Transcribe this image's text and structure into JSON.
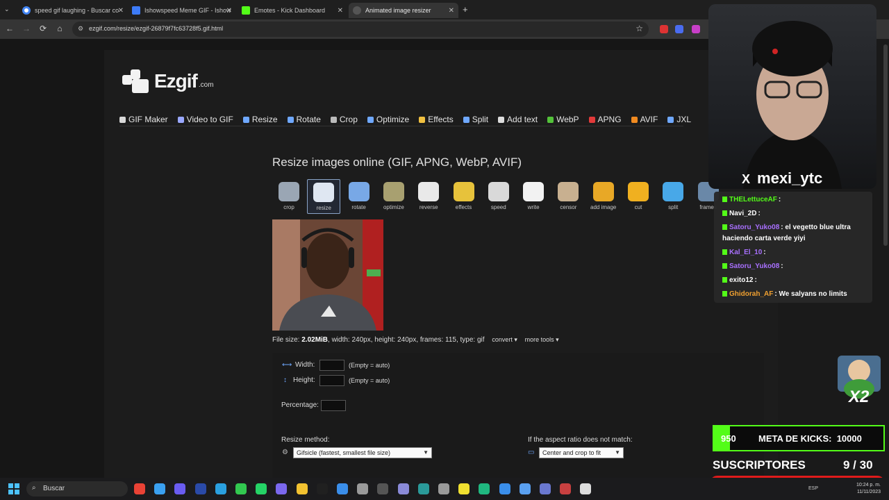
{
  "browser": {
    "tabs": [
      {
        "title": "speed gif laughing - Buscar co",
        "color": "#4285f4"
      },
      {
        "title": "Ishowspeed Meme GIF - Ishow",
        "color": "#3d7bf7"
      },
      {
        "title": "Emotes - Kick Dashboard",
        "color": "#53fc18"
      },
      {
        "title": "Animated image resizer",
        "color": "#2a2a2a"
      }
    ],
    "url": "ezgif.com/resize/ezgif-26879f7fc63728f5.gif.html",
    "new_tab": "+",
    "back": "←",
    "forward": "→",
    "reload": "⟳",
    "home": "⌂",
    "star": "☆"
  },
  "site": {
    "logo_text": "Ezgif",
    "logo_suffix": ".com",
    "nav": [
      {
        "label": "GIF Maker",
        "icon": "gif-maker-icon",
        "color": "#d8d8d8"
      },
      {
        "label": "Video to GIF",
        "icon": "video-icon",
        "color": "#9aa8ff"
      },
      {
        "label": "Resize",
        "icon": "resize-icon",
        "color": "#6fa8ff"
      },
      {
        "label": "Rotate",
        "icon": "rotate-icon",
        "color": "#6fa8ff"
      },
      {
        "label": "Crop",
        "icon": "crop-icon",
        "color": "#bbbbbb"
      },
      {
        "label": "Optimize",
        "icon": "optimize-icon",
        "color": "#6fa8ff"
      },
      {
        "label": "Effects",
        "icon": "effects-icon",
        "color": "#f0c040"
      },
      {
        "label": "Split",
        "icon": "split-icon",
        "color": "#6fa8ff"
      },
      {
        "label": "Add text",
        "icon": "add-text-icon",
        "color": "#dddddd"
      },
      {
        "label": "WebP",
        "icon": "webp-icon",
        "color": "#53c23a"
      },
      {
        "label": "APNG",
        "icon": "apng-icon",
        "color": "#e23a3a"
      },
      {
        "label": "AVIF",
        "icon": "avif-icon",
        "color": "#f08a20"
      },
      {
        "label": "JXL",
        "icon": "jxl-icon",
        "color": "#6fa8ff"
      }
    ],
    "heading": "Resize images online (GIF, APNG, WebP, AVIF)",
    "tools": [
      {
        "label": "crop",
        "color": "#9aa6b4"
      },
      {
        "label": "resize",
        "color": "#dfe7f2"
      },
      {
        "label": "rotate",
        "color": "#78a8e6"
      },
      {
        "label": "optimize",
        "color": "#a8a070"
      },
      {
        "label": "reverse",
        "color": "#e9e9e9"
      },
      {
        "label": "effects",
        "color": "#e7c23b"
      },
      {
        "label": "speed",
        "color": "#d9d9d9"
      },
      {
        "label": "write",
        "color": "#f2f2f2"
      },
      {
        "label": "censor",
        "color": "#c8b090"
      },
      {
        "label": "add image",
        "color": "#e8a826"
      },
      {
        "label": "cut",
        "color": "#f0b020"
      },
      {
        "label": "split",
        "color": "#48a8e8"
      },
      {
        "label": "frames",
        "color": "#6a88a8"
      }
    ],
    "file_info": {
      "prefix": "File size: ",
      "size": "2.02MiB",
      "rest": ", width: 240px, height: 240px, frames: 115, type: gif",
      "convert": "convert ▾",
      "more_tools": "more tools ▾"
    },
    "form": {
      "width_label": "Width:",
      "height_label": "Height:",
      "auto_hint": "(Empty = auto)",
      "percentage_label": "Percentage:",
      "method_label": "Resize method:",
      "method_value": "Gifsicle (fastest, smallest file size)",
      "aspect_label": "If the aspect ratio does not match:",
      "aspect_value": "Center and crop to fit"
    }
  },
  "stream": {
    "handle": "mexi_ytc",
    "x_glyph": "X",
    "chat": [
      {
        "user": "THELettuceAF",
        "text": ":",
        "color": "#53fc18"
      },
      {
        "user": "Navi_2D",
        "text": ":",
        "color": "#ffffff"
      },
      {
        "user": "Satoru_Yuko08",
        "text": ": el vegetto blue ultra haciendo carta verde yiyi",
        "color": "#a970ff"
      },
      {
        "user": "Kal_El_10",
        "text": ":",
        "color": "#a970ff"
      },
      {
        "user": "Satoru_Yuko08",
        "text": ":",
        "color": "#a970ff"
      },
      {
        "user": "exito12",
        "text": ":",
        "color": "#ffffff"
      },
      {
        "user": "Ghidorah_AF",
        "text": ": We salyans no limits",
        "color": "#f0a030"
      }
    ],
    "kicks_current": "950",
    "kicks_label": "META DE KICKS:",
    "kicks_goal": "10000",
    "kicks_progress": 0.095,
    "subs_label": "SUSCRIPTORES",
    "subs_value": "9 / 30",
    "subs_progress": 0.3,
    "badge_x2": "X2"
  },
  "taskbar": {
    "search_placeholder": "Buscar",
    "lang": "ESP",
    "time": "10:24 p. m.",
    "date": "11/11/2023"
  }
}
